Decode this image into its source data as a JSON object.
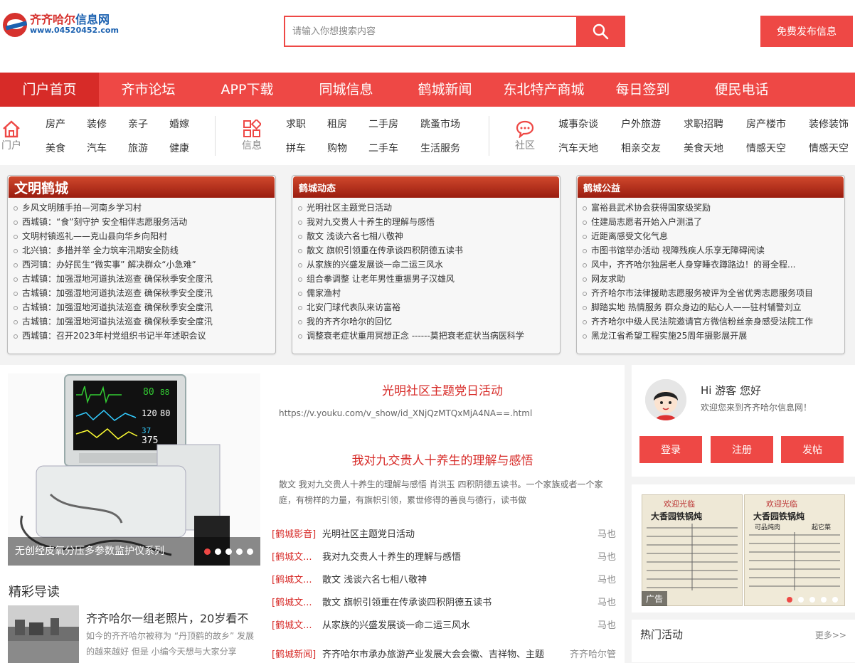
{
  "brand": {
    "name_red": "齐齐哈尔",
    "name_blue": "信息网",
    "url": "www.04520452.com"
  },
  "search": {
    "placeholder": "请输入你想搜索内容"
  },
  "publish_label": "免费发布信息",
  "nav": [
    "门户首页",
    "齐市论坛",
    "APP下载",
    "同城信息",
    "鹤城新闻",
    "东北特产商城",
    "每日签到",
    "便民电话"
  ],
  "categories": {
    "portal": {
      "label": "门户",
      "links": [
        "房产",
        "装修",
        "亲子",
        "婚嫁",
        "美食",
        "汽车",
        "旅游",
        "健康"
      ]
    },
    "info": {
      "label": "信息",
      "links": [
        "求职",
        "租房",
        "二手房",
        "跳蚤市场",
        "拼车",
        "购物",
        "二手车",
        "生活服务"
      ]
    },
    "community": {
      "label": "社区",
      "links": [
        "城事杂谈",
        "户外旅游",
        "求职招聘",
        "房产楼市",
        "装修装饰",
        "汽车天地",
        "相亲交友",
        "美食天地",
        "情感天空",
        "情感天空"
      ]
    }
  },
  "panels": [
    {
      "title": "文明鹤城",
      "items": [
        "乡风文明随手拍—河南乡学习村",
        "西城镇：“食”刻守护 安全相伴志愿服务活动",
        "文明村镇巡礼——克山县向华乡向阳村",
        "北兴镇：多措并举 全力筑牢汛期安全防线",
        "西河镇：办好民生“微实事” 解决群众“小急难”",
        "古城镇：加强湿地河道执法巡查 确保秋季安全度汛",
        "古城镇：加强湿地河道执法巡查 确保秋季安全度汛",
        "古城镇：加强湿地河道执法巡查 确保秋季安全度汛",
        "古城镇：加强湿地河道执法巡查 确保秋季安全度汛",
        "西城镇：召开2023年村党组织书记半年述职会议"
      ]
    },
    {
      "title": "鹤城动态",
      "items": [
        "光明社区主题党日活动",
        "我对九交贵人十养生的理解与感悟",
        "散文 浅谈六名七相八敬神",
        "散文 旗帜引领重在传承谈四积阴德五读书",
        "从家族的兴盛发展谈一命二运三风水",
        "组合拳调整 让老年男性重振男子汉雄风",
        "儒家渔村",
        "北安门球代表队来访富裕",
        "我的齐齐尔哈尔的回忆",
        "调整衰老症状重用冥想正念 ------莫把衰老症状当病医科学"
      ]
    },
    {
      "title": "鹤城公益",
      "items": [
        "富裕县武术协会获得国家级奖励",
        "住建局志愿者开始入户测温了",
        "近距离感受文化气息",
        "市图书馆举办活动 视障残疾人乐享无障碍阅读",
        "风中，齐齐哈尔独居老人身穿睡衣蹲路边！的哥全程...",
        "网友求助",
        "齐齐哈尔市法律援助志愿服务被评为全省优秀志愿服务项目",
        "脚踏实地 热情服务 群众身边的贴心人——驻村辅警刘立",
        "齐齐哈尔中级人民法院邀请官方微信粉丝亲身感受法院工作",
        "黑龙江省希望工程实施25周年摄影展开展"
      ]
    }
  ],
  "slider": {
    "caption": "无创经皮氧分压多参数监护仪系列",
    "monitor_values": [
      "80",
      "88",
      "120",
      "80",
      "37",
      "375"
    ]
  },
  "reading": {
    "section": "精彩导读",
    "title": "齐齐哈尔一组老照片，20岁看不",
    "desc": "如今的齐齐哈尔被称为 “丹顶鹤的故乡” 发展的越来越好 但是 小编今天想与大家分享"
  },
  "featured": [
    {
      "title": "光明社区主题党日活动",
      "text": "https://v.youku.com/v_show/id_XNjQzMTQxMjA4NA==.html"
    },
    {
      "title": "我对九交贵人十养生的理解与感悟",
      "text": "散文 我对九交贵人十养生的理解与感悟 肖洪玉 四积阴德五读书。一个家族或者一个家庭，有榜样的力量，有旗帜引领，累世修得的善良与德行，读书做"
    }
  ],
  "news": [
    {
      "tag": "[鹤城影音]",
      "title": "光明社区主题党日活动",
      "author": "马也"
    },
    {
      "tag": "[鹤城文...",
      "title": "我对九交贵人十养生的理解与感悟",
      "author": "马也"
    },
    {
      "tag": "[鹤城文...",
      "title": "散文 浅谈六名七相八敬神",
      "author": "马也"
    },
    {
      "tag": "[鹤城文...",
      "title": "散文 旗帜引领重在传承谈四积阴德五读书",
      "author": "马也"
    },
    {
      "tag": "[鹤城文...",
      "title": "从家族的兴盛发展谈一命二运三风水",
      "author": "马也"
    }
  ],
  "news_extra": {
    "tag": "[鹤城新闻]",
    "title": "齐齐哈尔市承办旅游产业发展大会会徽、吉祥物、主题",
    "author": "齐齐哈尔管"
  },
  "user": {
    "greeting": "Hi 游客 您好",
    "welcome": "欢迎您来到齐齐哈尔信息网！",
    "login": "登录",
    "register": "注册",
    "post": "发帖"
  },
  "ad": {
    "label": "广告",
    "menu_title": "欢迎光临",
    "menu_shop": "大香园铁锅炖",
    "menu_sub": "可品炖肉",
    "menu_tag": "起它菜"
  },
  "hot": {
    "title": "热门活动",
    "more": "更多>>"
  }
}
